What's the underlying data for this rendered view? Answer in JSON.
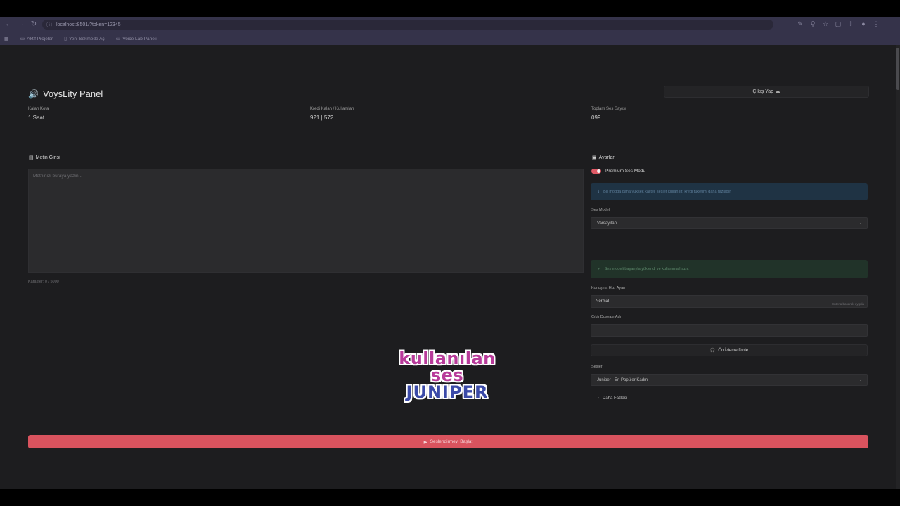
{
  "browser": {
    "url": "localhost:8501/?token=12345",
    "bookmarks": [
      "Aktif Projeler",
      "Yeni Sekmede Aç",
      "Voice Lab Paneli"
    ]
  },
  "app": {
    "title": "VoysLity Panel",
    "logout_label": "Çıkış Yap"
  },
  "stats": [
    {
      "label": "Kalan Kota",
      "value": "1 Saat"
    },
    {
      "label": "Kredi Kalan / Kullanılan",
      "value": "921 | 572"
    },
    {
      "label": "Toplam Ses Sayısı",
      "value": "099"
    }
  ],
  "editor": {
    "label": "Metin Girişi",
    "placeholder": "Metninizi buraya yazın...",
    "counter": "Karakter: 0 / 5000"
  },
  "settings": {
    "label": "Ayarlar",
    "toggle_label": "Premium Ses Modu",
    "info_text": "Bu modda daha yüksek kaliteli sesler kullanılır, kredi tüketimi daha fazladır.",
    "voice_model_label": "Ses Modeli",
    "voice_model_value": "Varsayılan",
    "success_text": "Ses modeli başarıyla yüklendi ve kullanıma hazır.",
    "speed_label": "Konuşma Hızı Ayarı",
    "speed_value": "Normal",
    "speed_hint": "Enter'a basarak uygula",
    "output_label": "Çıktı Dosyası Adı",
    "output_value": "",
    "preview_button": "Ön İzleme Dinle",
    "voice_label": "Sesler",
    "voice_value": "Juniper - En Popüler Kadın",
    "more_label": "Daha Fazlası"
  },
  "primary_button": "Seslendirmeyi Başlat",
  "overlay": {
    "line1": "kullanılan ses",
    "line2": "JUNIPER"
  },
  "colors": {
    "accent": "#d9535e",
    "info_bg": "#1f3344",
    "success_bg": "#213329",
    "page_bg": "#1d1d1f"
  }
}
